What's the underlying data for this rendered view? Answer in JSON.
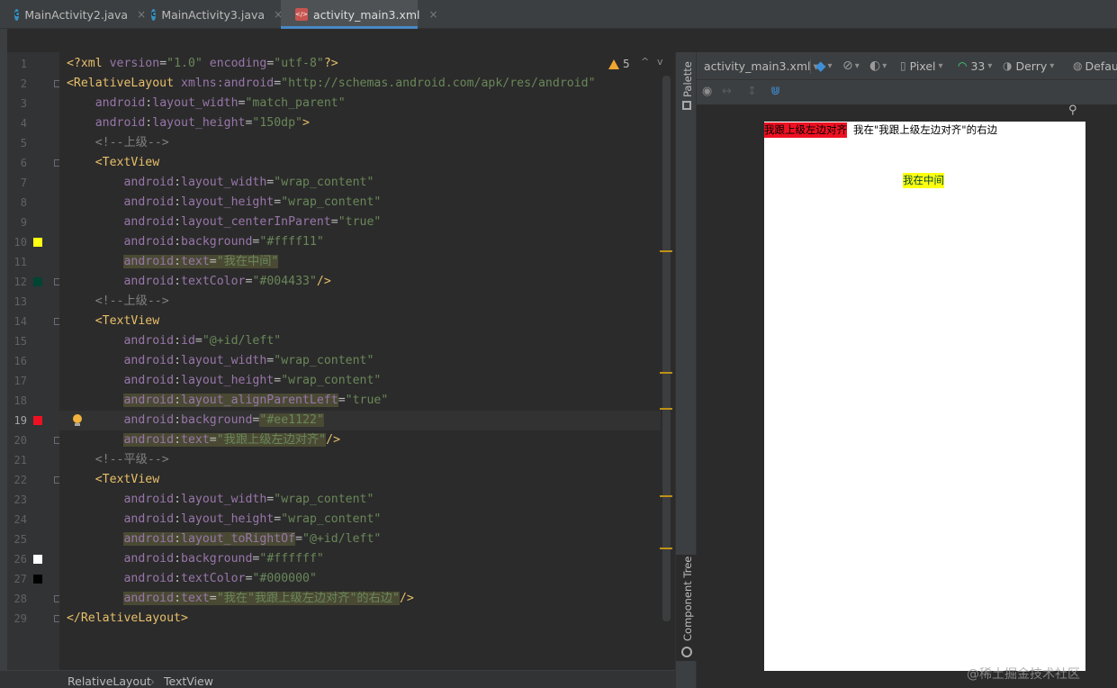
{
  "tabs": [
    {
      "label": "MainActivity2.java",
      "icon": "java-class-icon",
      "close": "×"
    },
    {
      "label": "MainActivity3.java",
      "icon": "java-class-icon",
      "close": "×"
    },
    {
      "label": "activity_main3.xml",
      "icon": "xml-file-icon",
      "close": "×",
      "active": true
    }
  ],
  "editor": {
    "warnings_count": "5",
    "lines": [
      {
        "n": "1",
        "parts": [
          [
            "p",
            "<?"
          ],
          [
            "t",
            "xml "
          ],
          [
            "a",
            "version"
          ],
          [
            "n",
            "="
          ],
          [
            "v",
            "\"1.0\""
          ],
          [
            "a",
            " encoding"
          ],
          [
            "n",
            "="
          ],
          [
            "v",
            "\"utf-8\""
          ],
          [
            "p",
            "?>"
          ]
        ]
      },
      {
        "n": "2",
        "parts": [
          [
            "t",
            "<RelativeLayout "
          ],
          [
            "a",
            "xmlns:"
          ],
          [
            "a",
            "android"
          ],
          [
            "n",
            "="
          ],
          [
            "v",
            "\"http://schemas.android.com/apk/res/android\""
          ]
        ]
      },
      {
        "n": "3",
        "parts": [
          [
            "n",
            "    "
          ],
          [
            "a",
            "android"
          ],
          [
            "n",
            ":"
          ],
          [
            "a",
            "layout_width"
          ],
          [
            "n",
            "="
          ],
          [
            "v",
            "\"match_parent\""
          ]
        ]
      },
      {
        "n": "4",
        "parts": [
          [
            "n",
            "    "
          ],
          [
            "a",
            "android"
          ],
          [
            "n",
            ":"
          ],
          [
            "a",
            "layout_height"
          ],
          [
            "n",
            "="
          ],
          [
            "v",
            "\"150dp\""
          ],
          [
            "t",
            ">"
          ]
        ]
      },
      {
        "n": "5",
        "parts": [
          [
            "c",
            "    <!--上级-->"
          ]
        ]
      },
      {
        "n": "6",
        "parts": [
          [
            "t",
            "    <TextView"
          ]
        ]
      },
      {
        "n": "7",
        "parts": [
          [
            "n",
            "        "
          ],
          [
            "a",
            "android"
          ],
          [
            "n",
            ":"
          ],
          [
            "a",
            "layout_width"
          ],
          [
            "n",
            "="
          ],
          [
            "v",
            "\"wrap_content\""
          ]
        ]
      },
      {
        "n": "8",
        "parts": [
          [
            "n",
            "        "
          ],
          [
            "a",
            "android"
          ],
          [
            "n",
            ":"
          ],
          [
            "a",
            "layout_height"
          ],
          [
            "n",
            "="
          ],
          [
            "v",
            "\"wrap_content\""
          ]
        ]
      },
      {
        "n": "9",
        "parts": [
          [
            "n",
            "        "
          ],
          [
            "a",
            "android"
          ],
          [
            "n",
            ":"
          ],
          [
            "a",
            "layout_centerInParent"
          ],
          [
            "n",
            "="
          ],
          [
            "v",
            "\"true\""
          ]
        ]
      },
      {
        "n": "10",
        "parts": [
          [
            "n",
            "        "
          ],
          [
            "a",
            "android"
          ],
          [
            "n",
            ":"
          ],
          [
            "a",
            "background"
          ],
          [
            "n",
            "="
          ],
          [
            "v",
            "\"#ffff11\""
          ]
        ]
      },
      {
        "n": "11",
        "parts": [
          [
            "n",
            "        "
          ],
          [
            "ah",
            "android"
          ],
          [
            "nh",
            ":"
          ],
          [
            "ah",
            "text"
          ],
          [
            "nh",
            "="
          ],
          [
            "vh",
            "\"我在中间\""
          ]
        ]
      },
      {
        "n": "12",
        "parts": [
          [
            "n",
            "        "
          ],
          [
            "a",
            "android"
          ],
          [
            "n",
            ":"
          ],
          [
            "a",
            "textColor"
          ],
          [
            "n",
            "="
          ],
          [
            "v",
            "\"#004433\""
          ],
          [
            "t",
            "/>"
          ]
        ]
      },
      {
        "n": "13",
        "parts": [
          [
            "c",
            "    <!--上级-->"
          ]
        ]
      },
      {
        "n": "14",
        "parts": [
          [
            "t",
            "    <TextView"
          ]
        ]
      },
      {
        "n": "15",
        "parts": [
          [
            "n",
            "        "
          ],
          [
            "a",
            "android"
          ],
          [
            "n",
            ":"
          ],
          [
            "a",
            "id"
          ],
          [
            "n",
            "="
          ],
          [
            "v",
            "\"@+id/left\""
          ]
        ]
      },
      {
        "n": "16",
        "parts": [
          [
            "n",
            "        "
          ],
          [
            "a",
            "android"
          ],
          [
            "n",
            ":"
          ],
          [
            "a",
            "layout_width"
          ],
          [
            "n",
            "="
          ],
          [
            "v",
            "\"wrap_content\""
          ]
        ]
      },
      {
        "n": "17",
        "parts": [
          [
            "n",
            "        "
          ],
          [
            "a",
            "android"
          ],
          [
            "n",
            ":"
          ],
          [
            "a",
            "layout_height"
          ],
          [
            "n",
            "="
          ],
          [
            "v",
            "\"wrap_content\""
          ]
        ]
      },
      {
        "n": "18",
        "parts": [
          [
            "n",
            "        "
          ],
          [
            "ah",
            "android"
          ],
          [
            "nh",
            ":"
          ],
          [
            "ah",
            "layout_alignParentLeft"
          ],
          [
            "n",
            "="
          ],
          [
            "v",
            "\"true\""
          ]
        ]
      },
      {
        "n": "19",
        "parts": [
          [
            "n",
            "        "
          ],
          [
            "a",
            "android"
          ],
          [
            "n",
            ":"
          ],
          [
            "a",
            "background"
          ],
          [
            "n",
            "="
          ],
          [
            "vh",
            "\"#ee1122\""
          ]
        ]
      },
      {
        "n": "20",
        "parts": [
          [
            "n",
            "        "
          ],
          [
            "ah",
            "android"
          ],
          [
            "nh",
            ":"
          ],
          [
            "ah",
            "text"
          ],
          [
            "nh",
            "="
          ],
          [
            "vh",
            "\"我跟上级左边对齐\""
          ],
          [
            "t",
            "/>"
          ]
        ]
      },
      {
        "n": "21",
        "parts": [
          [
            "c",
            "    <!--平级-->"
          ]
        ]
      },
      {
        "n": "22",
        "parts": [
          [
            "t",
            "    <TextView"
          ]
        ]
      },
      {
        "n": "23",
        "parts": [
          [
            "n",
            "        "
          ],
          [
            "a",
            "android"
          ],
          [
            "n",
            ":"
          ],
          [
            "a",
            "layout_width"
          ],
          [
            "n",
            "="
          ],
          [
            "v",
            "\"wrap_content\""
          ]
        ]
      },
      {
        "n": "24",
        "parts": [
          [
            "n",
            "        "
          ],
          [
            "a",
            "android"
          ],
          [
            "n",
            ":"
          ],
          [
            "a",
            "layout_height"
          ],
          [
            "n",
            "="
          ],
          [
            "v",
            "\"wrap_content\""
          ]
        ]
      },
      {
        "n": "25",
        "parts": [
          [
            "n",
            "        "
          ],
          [
            "ah",
            "android"
          ],
          [
            "nh",
            ":"
          ],
          [
            "ah",
            "layout_toRightOf"
          ],
          [
            "n",
            "="
          ],
          [
            "v",
            "\"@+id/left\""
          ]
        ]
      },
      {
        "n": "26",
        "parts": [
          [
            "n",
            "        "
          ],
          [
            "a",
            "android"
          ],
          [
            "n",
            ":"
          ],
          [
            "a",
            "background"
          ],
          [
            "n",
            "="
          ],
          [
            "v",
            "\"#ffffff\""
          ]
        ]
      },
      {
        "n": "27",
        "parts": [
          [
            "n",
            "        "
          ],
          [
            "a",
            "android"
          ],
          [
            "n",
            ":"
          ],
          [
            "a",
            "textColor"
          ],
          [
            "n",
            "="
          ],
          [
            "v",
            "\"#000000\""
          ]
        ]
      },
      {
        "n": "28",
        "parts": [
          [
            "n",
            "        "
          ],
          [
            "ah",
            "android"
          ],
          [
            "nh",
            ":"
          ],
          [
            "ah",
            "text"
          ],
          [
            "nh",
            "="
          ],
          [
            "vh",
            "\"我在\"我跟上级左边对齐\"的右边\""
          ],
          [
            "t",
            "/>"
          ]
        ]
      },
      {
        "n": "29",
        "parts": [
          [
            "t",
            "</RelativeLayout>"
          ]
        ]
      }
    ],
    "current_line": "19",
    "color_swatches": [
      {
        "line": "10",
        "color": "#ffff11"
      },
      {
        "line": "12",
        "color": "#004433"
      },
      {
        "line": "19",
        "color": "#ee1122"
      },
      {
        "line": "26",
        "color": "#ffffff"
      },
      {
        "line": "27",
        "color": "#000000"
      }
    ]
  },
  "breadcrumb": {
    "items": [
      "RelativeLayout",
      "TextView"
    ],
    "separator": "›"
  },
  "side_panel": {
    "palette": "Palette",
    "component_tree": "Component Tree"
  },
  "design_toolbar": {
    "file": "activity_main3.xml",
    "device": "Pixel",
    "api": "33",
    "theme": "Derry",
    "locale": "Defau"
  },
  "preview": {
    "left_text": "我跟上级左边对齐",
    "right_text": "我在\"我跟上级左边对齐\"的右边",
    "center_text": "我在中间",
    "colors": {
      "left_bg": "#ee1122",
      "center_bg": "#ffff11",
      "center_fg": "#004433",
      "right_bg": "#ffffff",
      "right_fg": "#000000"
    }
  },
  "watermark": "@稀土掘金技术社区"
}
